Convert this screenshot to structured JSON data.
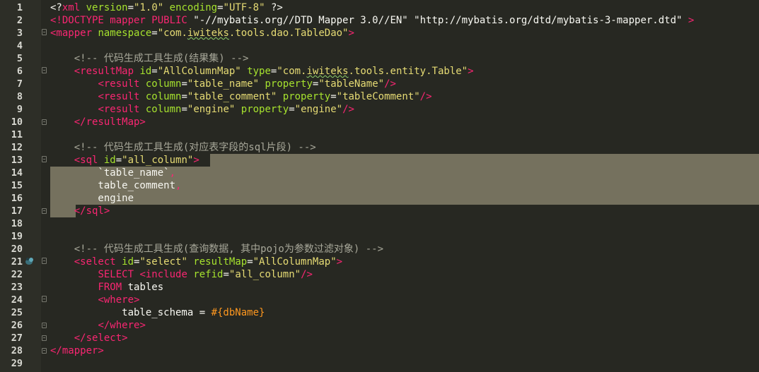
{
  "colors": {
    "background": "#272822",
    "gutter": "#2d2e27",
    "highlight": "#75715e",
    "tag": "#f92672",
    "attribute": "#a6e22e",
    "string": "#e6db74",
    "comment": "#a8a89a",
    "keyword": "#f92672",
    "variable": "#fd971f",
    "plain": "#f8f8f2"
  },
  "icons": {
    "breakpoint_marker": "bug-marker-icon",
    "fold_open": "fold-open-icon",
    "fold_close": "fold-close-icon"
  },
  "lines": [
    {
      "n": "1",
      "tokens": [
        [
          "pl",
          "<?"
        ],
        [
          "tag",
          "xml"
        ],
        [
          "pl",
          " "
        ],
        [
          "attr",
          "version"
        ],
        [
          "pl",
          "="
        ],
        [
          "str",
          "\"1.0\""
        ],
        [
          "pl",
          " "
        ],
        [
          "attr",
          "encoding"
        ],
        [
          "pl",
          "="
        ],
        [
          "str",
          "\"UTF-8\""
        ],
        [
          "pl",
          " ?>"
        ]
      ]
    },
    {
      "n": "2",
      "tokens": [
        [
          "tag",
          "<!DOCTYPE mapper PUBLIC "
        ],
        [
          "pl",
          "\"-//mybatis.org//DTD Mapper 3.0//EN\" \"http://mybatis.org/dtd/mybatis-3-mapper.dtd\" "
        ],
        [
          "tag",
          ">"
        ]
      ]
    },
    {
      "n": "3",
      "tokens": [
        [
          "tag",
          "<mapper "
        ],
        [
          "attr",
          "namespace"
        ],
        [
          "pl",
          "="
        ],
        [
          "str",
          "\"com."
        ],
        [
          "str-sq",
          "iwiteks"
        ],
        [
          "str",
          ".tools.dao.TableDao\""
        ],
        [
          "tag",
          ">"
        ]
      ]
    },
    {
      "n": "4",
      "tokens": []
    },
    {
      "n": "5",
      "tokens": [
        [
          "pl",
          "    "
        ],
        [
          "cmt",
          "<!-- 代码生成工具生成(结果集) -->"
        ]
      ]
    },
    {
      "n": "6",
      "tokens": [
        [
          "pl",
          "    "
        ],
        [
          "tag",
          "<resultMap "
        ],
        [
          "attr",
          "id"
        ],
        [
          "pl",
          "="
        ],
        [
          "str",
          "\"AllColumnMap\""
        ],
        [
          "pl",
          " "
        ],
        [
          "attr",
          "type"
        ],
        [
          "pl",
          "="
        ],
        [
          "str",
          "\"com."
        ],
        [
          "str-sq",
          "iwiteks"
        ],
        [
          "str",
          ".tools.entity.Table\""
        ],
        [
          "tag",
          ">"
        ]
      ]
    },
    {
      "n": "7",
      "tokens": [
        [
          "pl",
          "        "
        ],
        [
          "tag",
          "<result "
        ],
        [
          "attr",
          "column"
        ],
        [
          "pl",
          "="
        ],
        [
          "str",
          "\"table_name\""
        ],
        [
          "pl",
          " "
        ],
        [
          "attr",
          "property"
        ],
        [
          "pl",
          "="
        ],
        [
          "str",
          "\"tableName\""
        ],
        [
          "tag",
          "/>"
        ]
      ]
    },
    {
      "n": "8",
      "tokens": [
        [
          "pl",
          "        "
        ],
        [
          "tag",
          "<result "
        ],
        [
          "attr",
          "column"
        ],
        [
          "pl",
          "="
        ],
        [
          "str",
          "\"table_comment\""
        ],
        [
          "pl",
          " "
        ],
        [
          "attr",
          "property"
        ],
        [
          "pl",
          "="
        ],
        [
          "str",
          "\"tableComment\""
        ],
        [
          "tag",
          "/>"
        ]
      ]
    },
    {
      "n": "9",
      "tokens": [
        [
          "pl",
          "        "
        ],
        [
          "tag",
          "<result "
        ],
        [
          "attr",
          "column"
        ],
        [
          "pl",
          "="
        ],
        [
          "str",
          "\"engine\""
        ],
        [
          "pl",
          " "
        ],
        [
          "attr",
          "property"
        ],
        [
          "pl",
          "="
        ],
        [
          "str",
          "\"engine\""
        ],
        [
          "tag",
          "/>"
        ]
      ]
    },
    {
      "n": "10",
      "tokens": [
        [
          "pl",
          "    "
        ],
        [
          "tag",
          "</resultMap>"
        ]
      ]
    },
    {
      "n": "11",
      "tokens": []
    },
    {
      "n": "12",
      "tokens": [
        [
          "pl",
          "    "
        ],
        [
          "cmt",
          "<!-- 代码生成工具生成(对应表字段的sql片段) -->"
        ]
      ]
    },
    {
      "n": "13",
      "tokens": [
        [
          "pl",
          "    "
        ],
        [
          "tag",
          "<sql "
        ],
        [
          "attr",
          "id"
        ],
        [
          "pl",
          "="
        ],
        [
          "str",
          "\"all_column\""
        ],
        [
          "tag",
          ">"
        ]
      ]
    },
    {
      "n": "14",
      "tokens": [
        [
          "pl",
          "        `table_name`"
        ],
        [
          "tag",
          ","
        ]
      ]
    },
    {
      "n": "15",
      "tokens": [
        [
          "pl",
          "        table_comment"
        ],
        [
          "tag",
          ","
        ]
      ]
    },
    {
      "n": "16",
      "tokens": [
        [
          "pl",
          "        engine"
        ]
      ]
    },
    {
      "n": "17",
      "tokens": [
        [
          "pl",
          "    "
        ],
        [
          "tag",
          "</sql>"
        ]
      ]
    },
    {
      "n": "18",
      "tokens": []
    },
    {
      "n": "19",
      "tokens": []
    },
    {
      "n": "20",
      "tokens": [
        [
          "pl",
          "    "
        ],
        [
          "cmt",
          "<!-- 代码生成工具生成(查询数据, 其中pojo为参数过滤对象) -->"
        ]
      ]
    },
    {
      "n": "21",
      "tokens": [
        [
          "pl",
          "    "
        ],
        [
          "tag",
          "<select "
        ],
        [
          "attr",
          "id"
        ],
        [
          "pl",
          "="
        ],
        [
          "str",
          "\"select\""
        ],
        [
          "pl",
          " "
        ],
        [
          "attr",
          "resultMap"
        ],
        [
          "pl",
          "="
        ],
        [
          "str",
          "\"AllColumnMap\""
        ],
        [
          "tag",
          ">"
        ]
      ]
    },
    {
      "n": "22",
      "tokens": [
        [
          "pl",
          "        "
        ],
        [
          "kw",
          "SELECT "
        ],
        [
          "tag",
          "<include "
        ],
        [
          "attr",
          "refid"
        ],
        [
          "pl",
          "="
        ],
        [
          "str",
          "\"all_column\""
        ],
        [
          "tag",
          "/>"
        ]
      ]
    },
    {
      "n": "23",
      "tokens": [
        [
          "pl",
          "        "
        ],
        [
          "kw",
          "FROM"
        ],
        [
          "pl",
          " tables"
        ]
      ]
    },
    {
      "n": "24",
      "tokens": [
        [
          "pl",
          "        "
        ],
        [
          "tag",
          "<where>"
        ]
      ]
    },
    {
      "n": "25",
      "tokens": [
        [
          "pl",
          "            table_schema = "
        ],
        [
          "var",
          "#{dbName}"
        ]
      ]
    },
    {
      "n": "26",
      "tokens": [
        [
          "pl",
          "        "
        ],
        [
          "tag",
          "</where>"
        ]
      ]
    },
    {
      "n": "27",
      "tokens": [
        [
          "pl",
          "    "
        ],
        [
          "tag",
          "</select>"
        ]
      ]
    },
    {
      "n": "28",
      "tokens": [
        [
          "tag",
          "</mapper>"
        ]
      ]
    },
    {
      "n": "29",
      "tokens": []
    }
  ]
}
